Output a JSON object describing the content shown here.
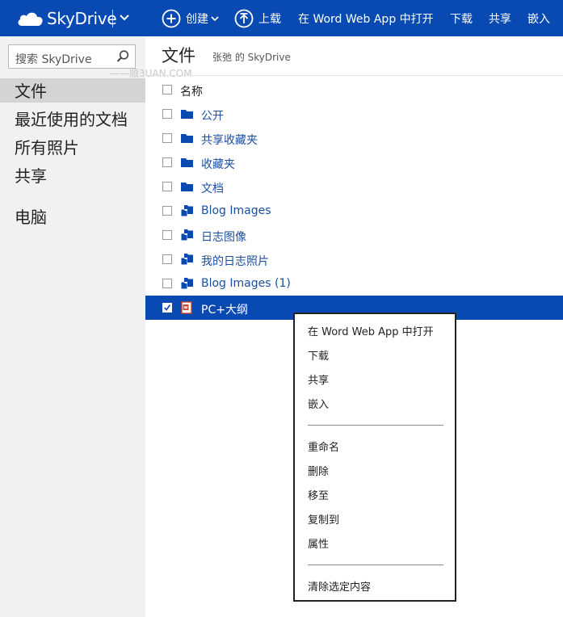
{
  "app": {
    "brand": "SkyDrive"
  },
  "toolbar": {
    "create_label": "创建",
    "upload_label": "上载",
    "open_word_label": "在 Word Web App 中打开",
    "download_label": "下载",
    "share_label": "共享",
    "embed_label": "嵌入"
  },
  "search": {
    "placeholder": "搜索 SkyDrive"
  },
  "nav": {
    "files": "文件",
    "recent": "最近使用的文档",
    "photos": "所有照片",
    "shared": "共享",
    "pcs": "电脑"
  },
  "main": {
    "title": "文件",
    "subtitle": "张弛 的 SkyDrive",
    "watermark": "——顺3UAN.COM",
    "column_name": "名称",
    "items": [
      {
        "label": "公开",
        "icon": "folder-icon",
        "selected": false
      },
      {
        "label": "共享收藏夹",
        "icon": "folder-icon",
        "selected": false
      },
      {
        "label": "收藏夹",
        "icon": "folder-icon",
        "selected": false
      },
      {
        "label": "文档",
        "icon": "folder-icon",
        "selected": false
      },
      {
        "label": "Blog Images",
        "icon": "shared-folder-icon",
        "selected": false
      },
      {
        "label": "日志图像",
        "icon": "shared-folder-icon",
        "selected": false
      },
      {
        "label": "我的日志照片",
        "icon": "shared-folder-icon",
        "selected": false
      },
      {
        "label": "Blog Images (1)",
        "icon": "shared-folder-icon",
        "selected": false
      },
      {
        "label": "PC+大纲",
        "icon": "word-doc-icon",
        "selected": true
      }
    ]
  },
  "context_menu": {
    "open_word": "在 Word Web App 中打开",
    "download": "下载",
    "share": "共享",
    "embed": "嵌入",
    "rename": "重命名",
    "delete": "删除",
    "move_to": "移至",
    "copy_to": "复制到",
    "properties": "属性",
    "clear_selection": "清除选定内容"
  },
  "colors": {
    "accent": "#094ab2",
    "link": "#1a4fa0",
    "nav_bg": "#f1f1f1",
    "word_icon": "#c8432c"
  }
}
